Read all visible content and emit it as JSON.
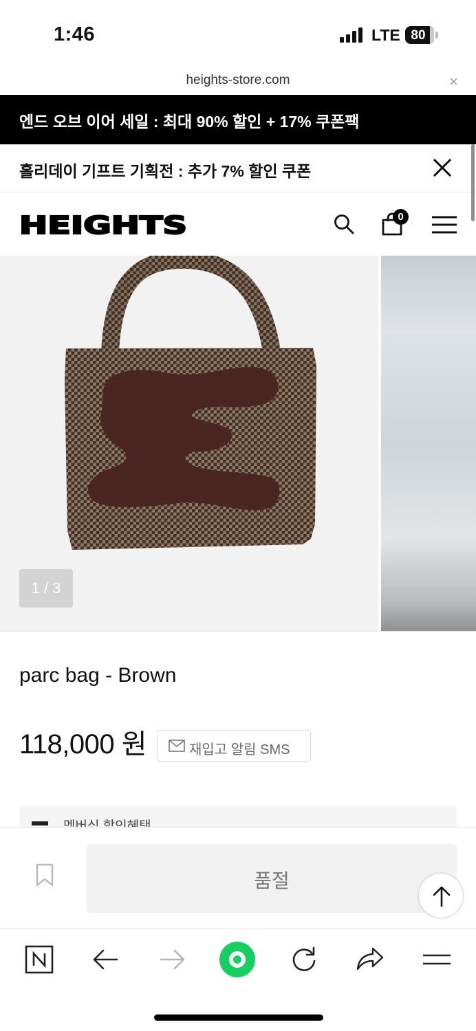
{
  "status_bar": {
    "time": "1:46",
    "network": "LTE",
    "battery": "80"
  },
  "browser": {
    "url": "heights-store.com",
    "close_glyph": "×"
  },
  "banners": {
    "promo_sale": "엔드 오브 이어 세일 : 최대 90% 할인 + 17% 쿠폰팩",
    "promo_holiday": "홀리데이 기프트 기획전 : 추가 7% 할인 쿠폰"
  },
  "header": {
    "logo": "HEIGHTS",
    "cart_count": "0",
    "icons": [
      "search-icon",
      "cart-icon",
      "menu-icon"
    ]
  },
  "gallery": {
    "counter": "1 / 3",
    "current_index": 1,
    "total": 3
  },
  "product": {
    "name": "parc bag - Brown",
    "price": "118,000 원",
    "restock_label": "재입고 알림 SMS",
    "membership_label": "멤버십 할인혜택"
  },
  "purchase_bar": {
    "soldout_label": "품절"
  },
  "toolbar": {
    "icons": [
      "naver-home-icon",
      "back-arrow-icon",
      "forward-arrow-icon",
      "green-dot-icon",
      "refresh-icon",
      "share-icon",
      "menu-icon"
    ]
  },
  "colors": {
    "banner_bg": "#000000",
    "accent_green": "#19ce60",
    "soldout_bg": "#f1f1f1",
    "bag_main": "#7a6452",
    "bag_patch": "#4a2621"
  }
}
